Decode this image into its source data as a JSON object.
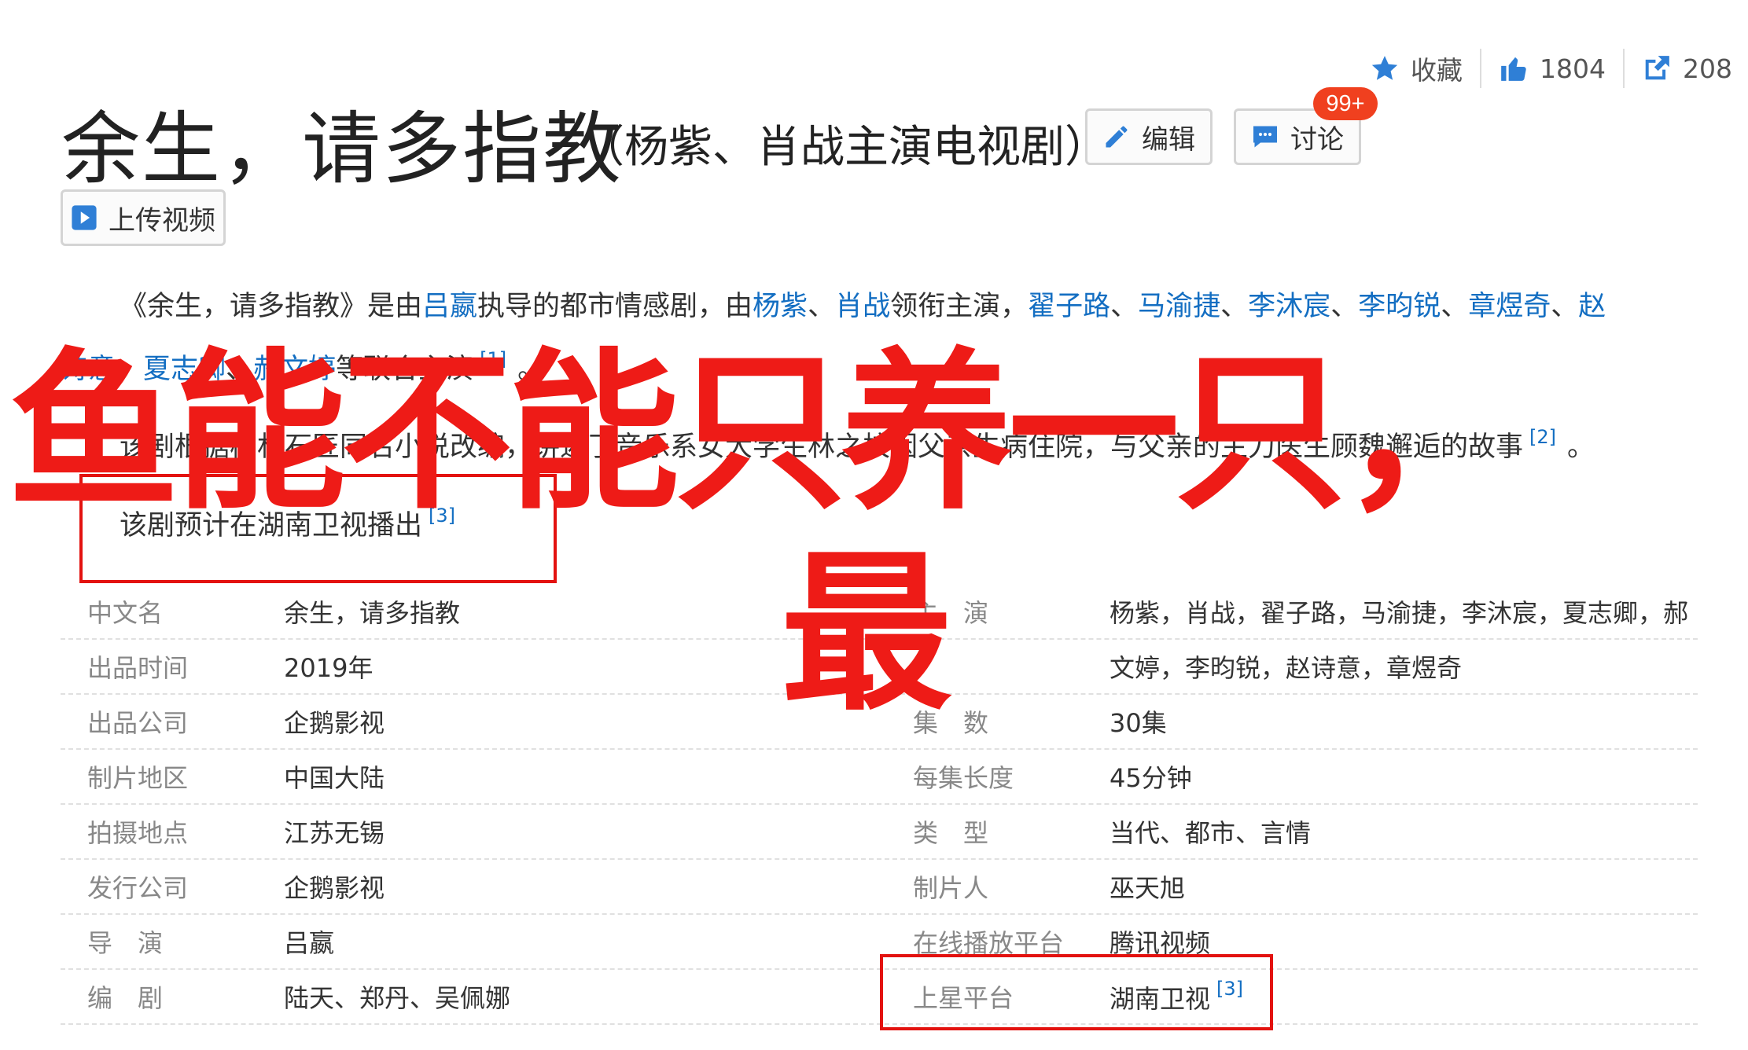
{
  "stats": {
    "collect_label": "收藏",
    "like_count": "1804",
    "share_count": "208"
  },
  "header": {
    "title": "余生，请多指教",
    "subtitle": "（杨紫、肖战主演电视剧）",
    "edit_label": "编辑",
    "discuss_label": "讨论",
    "discuss_badge": "99+",
    "upload_label": "上传视频"
  },
  "para1": {
    "line1": {
      "t1": "《余生，请多指教》是由",
      "director": "吕嬴",
      "t2": "执导的都市情感剧，由",
      "a1": "杨紫",
      "s1": "、",
      "a2": "肖战",
      "t3": "领衔主演，",
      "a3": "翟子路",
      "s2": "、",
      "a4": "马渝捷",
      "s3": "、",
      "a5": "李沐宸",
      "s4": "、",
      "a6": "李昀锐",
      "s5": "、",
      "a7": "章煜奇",
      "s6": "、",
      "a8a": "赵"
    },
    "line2": {
      "a8b": "诗意",
      "s1": "、",
      "a9": "夏志卿",
      "s2": "、",
      "a10": "郝文婷",
      "t1": "等联合主演",
      "ref": "[1]",
      "end": "。"
    }
  },
  "para2": {
    "text": "该剧根据柏林石匠同名小说改编，讲述了音乐系女大学生林之校因父亲生病住院，与父亲的主刀医生顾魏邂逅的故事",
    "ref": "[2]",
    "end": "。"
  },
  "para3": {
    "text": "该剧预计在湖南卫视播出",
    "ref": "[3]"
  },
  "table": {
    "rows": [
      {
        "l1": "中文名",
        "v1": "余生，请多指教",
        "l2": "主　演",
        "v2": "杨紫，肖战，翟子路，马渝捷，李沐宸，夏志卿，郝"
      },
      {
        "l1": "出品时间",
        "v1": "2019年",
        "l2": "",
        "v2": "文婷，李昀锐，赵诗意，章煜奇"
      },
      {
        "l1": "出品公司",
        "v1": "企鹅影视",
        "l2": "集　数",
        "v2": "30集"
      },
      {
        "l1": "制片地区",
        "v1": "中国大陆",
        "l2": "每集长度",
        "v2": "45分钟"
      },
      {
        "l1": "拍摄地点",
        "v1": "江苏无锡",
        "l2": "类　型",
        "v2": "当代、都市、言情"
      },
      {
        "l1": "发行公司",
        "v1": "企鹅影视",
        "l2": "制片人",
        "v2": "巫天旭"
      },
      {
        "l1": "导　演",
        "v1": "吕嬴",
        "l2": "在线播放平台",
        "v2": "腾讯视频"
      },
      {
        "l1": "编　剧",
        "v1": "陆天、郑丹、吴佩娜",
        "l2": "上星平台",
        "v2": "湖南卫视",
        "ref": "[3]"
      }
    ]
  },
  "overlay": {
    "line1": "鱼能不能只养一只，",
    "line2": "最",
    "color": "#ee1b17"
  }
}
